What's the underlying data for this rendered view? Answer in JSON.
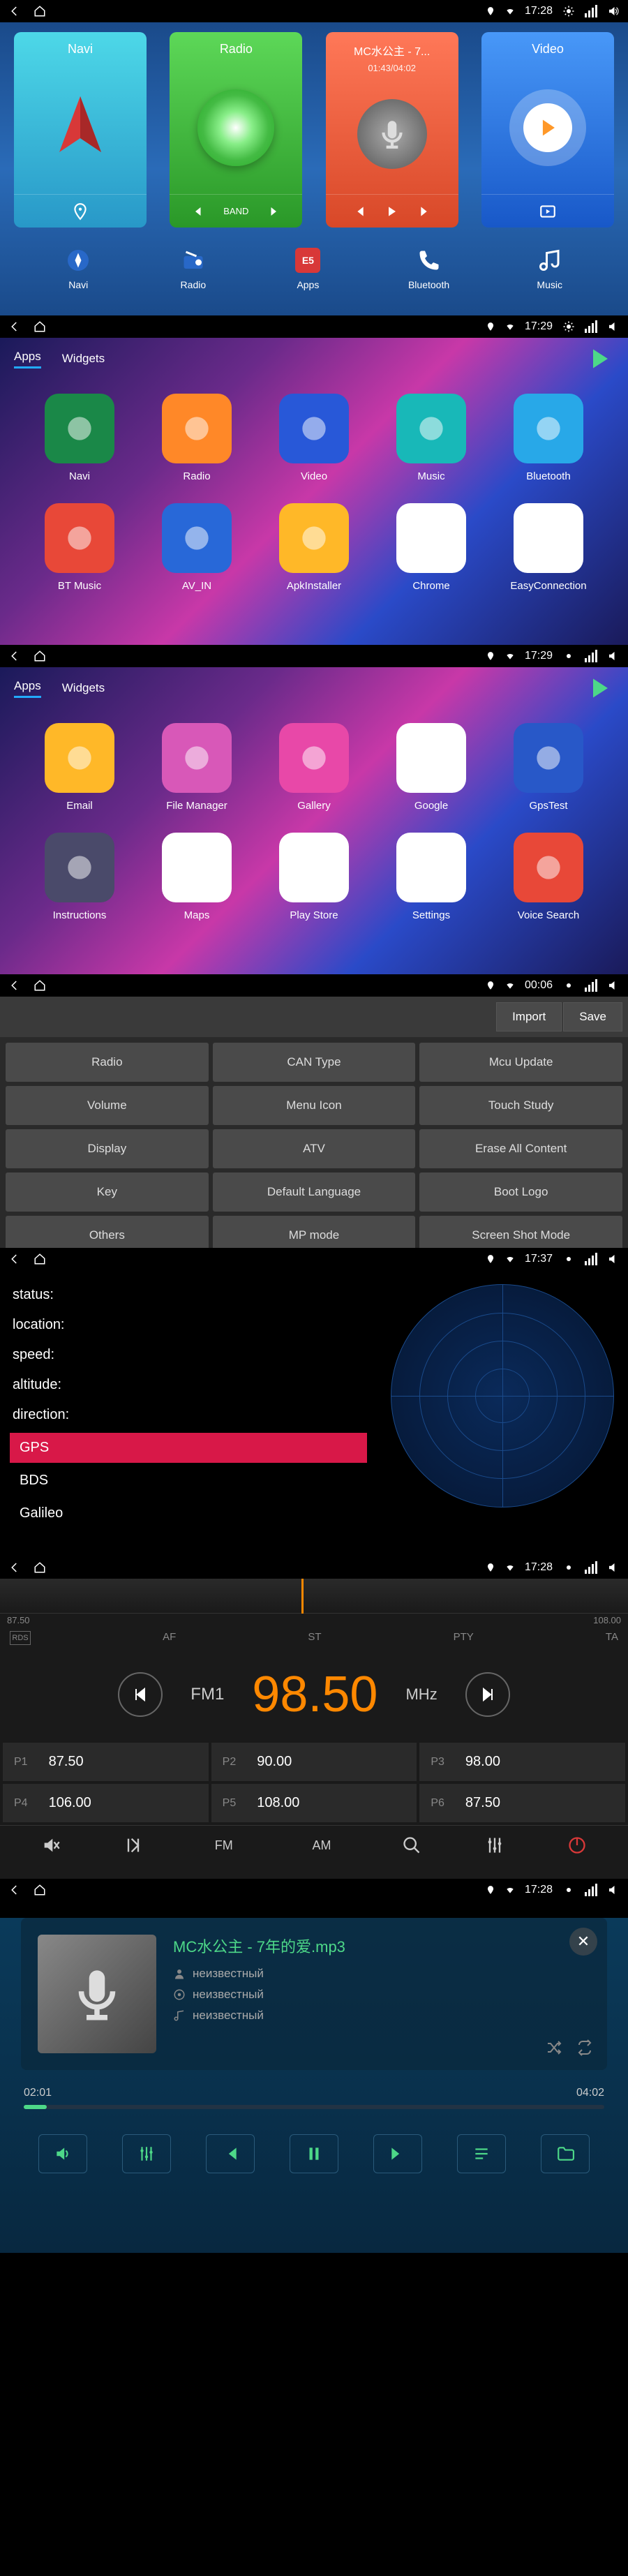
{
  "statusbar": {
    "time1": "17:28",
    "time2": "17:29",
    "time3": "17:29",
    "time4": "00:06",
    "time5": "17:37",
    "time6": "17:28",
    "time7": "17:28"
  },
  "home": {
    "tiles": {
      "navi": {
        "title": "Navi"
      },
      "radio": {
        "title": "Radio",
        "band": "BAND"
      },
      "mc": {
        "title": "MC水公主 - 7...",
        "time": "01:43/04:02"
      },
      "video": {
        "title": "Video"
      }
    },
    "dock": [
      {
        "label": "Navi"
      },
      {
        "label": "Radio"
      },
      {
        "label": "Apps"
      },
      {
        "label": "Bluetooth"
      },
      {
        "label": "Music"
      }
    ]
  },
  "apps": {
    "tabs": {
      "apps": "Apps",
      "widgets": "Widgets"
    },
    "page1": [
      {
        "label": "Navi",
        "bg": "#1a8848"
      },
      {
        "label": "Radio",
        "bg": "#ff8828"
      },
      {
        "label": "Video",
        "bg": "#2858d8"
      },
      {
        "label": "Music",
        "bg": "#18b8b8"
      },
      {
        "label": "Bluetooth",
        "bg": "#28a8e8"
      },
      {
        "label": "BT Music",
        "bg": "#e84838"
      },
      {
        "label": "AV_IN",
        "bg": "#2868d8"
      },
      {
        "label": "ApkInstaller",
        "bg": "#ffb828"
      },
      {
        "label": "Chrome",
        "bg": "#fff"
      },
      {
        "label": "EasyConnection",
        "bg": "#fff"
      }
    ],
    "page2": [
      {
        "label": "Email",
        "bg": "#ffb828"
      },
      {
        "label": "File Manager",
        "bg": "#d858b8"
      },
      {
        "label": "Gallery",
        "bg": "#e848a8"
      },
      {
        "label": "Google",
        "bg": "#fff"
      },
      {
        "label": "GpsTest",
        "bg": "#2858c8"
      },
      {
        "label": "Instructions",
        "bg": "#4a4a6a"
      },
      {
        "label": "Maps",
        "bg": "#fff"
      },
      {
        "label": "Play Store",
        "bg": "#fff"
      },
      {
        "label": "Settings",
        "bg": "#fff"
      },
      {
        "label": "Voice Search",
        "bg": "#e84838"
      }
    ]
  },
  "settings": {
    "import": "Import",
    "save": "Save",
    "cells": [
      "Radio",
      "CAN Type",
      "Mcu Update",
      "Volume",
      "Menu Icon",
      "Touch Study",
      "Display",
      "ATV",
      "Erase All Content",
      "Key",
      "Default Language",
      "Boot Logo",
      "Others",
      "MP mode",
      "Screen Shot Mode"
    ]
  },
  "gps": {
    "rows": {
      "status": "status:",
      "location": "location:",
      "speed": "speed:",
      "altitude": "altitude:",
      "direction": "direction:"
    },
    "sats": [
      "GPS",
      "BDS",
      "Galileo"
    ]
  },
  "radio": {
    "dial": {
      "left": "87.50",
      "right": "108.00"
    },
    "labels": {
      "rds": "RDS",
      "af": "AF",
      "st": "ST",
      "pty": "PTY",
      "ta": "TA"
    },
    "band": "FM1",
    "freq": "98.50",
    "unit": "MHz",
    "presets": [
      {
        "p": "P1",
        "v": "87.50"
      },
      {
        "p": "P2",
        "v": "90.00"
      },
      {
        "p": "P3",
        "v": "98.00"
      },
      {
        "p": "P4",
        "v": "106.00"
      },
      {
        "p": "P5",
        "v": "108.00"
      },
      {
        "p": "P6",
        "v": "87.50"
      }
    ],
    "bottom": {
      "fm": "FM",
      "am": "AM"
    }
  },
  "player": {
    "title": "MC水公主 - 7年的爱.mp3",
    "meta1": "неизвестный",
    "meta2": "неизвестный",
    "meta3": "неизвестный",
    "elapsed": "02:01",
    "total": "04:02"
  }
}
